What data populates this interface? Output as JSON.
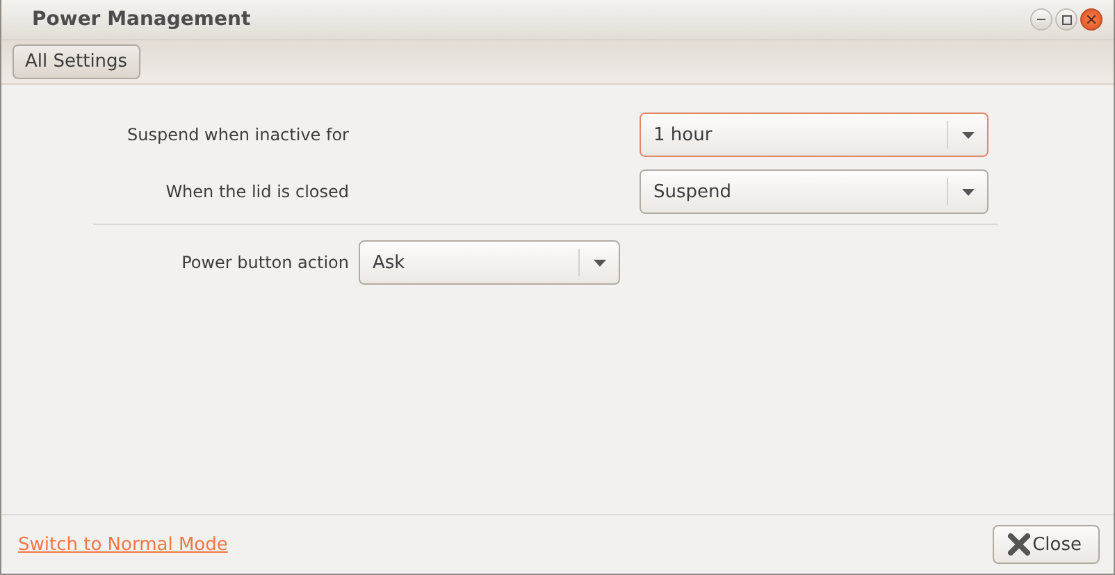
{
  "window": {
    "title": "Power Management"
  },
  "toolbar": {
    "button": "All Settings"
  },
  "settings": [
    {
      "label": "Suspend when inactive for",
      "value": "1 hour",
      "focused": true
    },
    {
      "label": "When the lid is closed",
      "value": "Suspend",
      "focused": false
    },
    {
      "label": "Power button action",
      "value": "Ask",
      "focused": false
    }
  ],
  "footer": {
    "link": "Switch to Normal Mode",
    "close": "Close"
  }
}
